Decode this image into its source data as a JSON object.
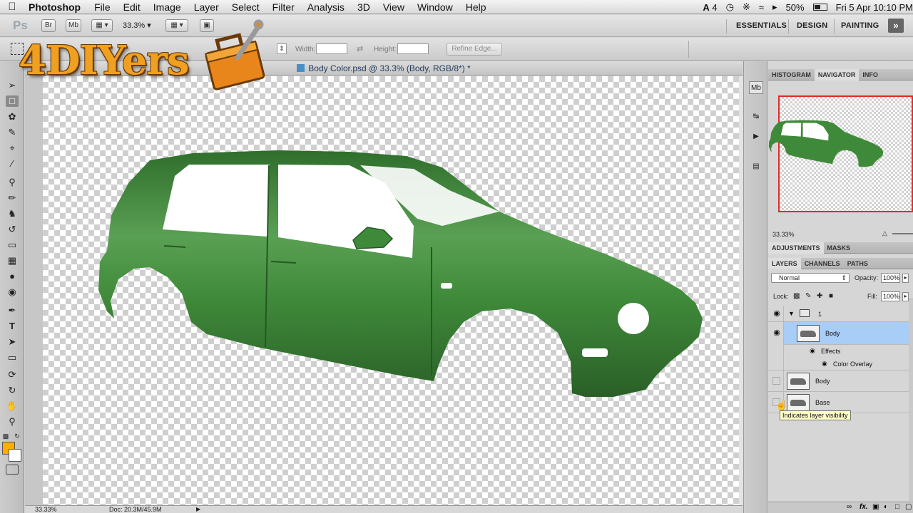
{
  "menubar": {
    "app_name": "Photoshop",
    "items": [
      "File",
      "Edit",
      "Image",
      "Layer",
      "Select",
      "Filter",
      "Analysis",
      "3D",
      "View",
      "Window",
      "Help"
    ],
    "status": {
      "adobe_count": "4",
      "battery": "50%",
      "datetime": "Fri 5 Apr  10:10 PM"
    }
  },
  "appbar": {
    "ps_logo": "Ps",
    "br_label": "Br",
    "mb_label": "Mb",
    "zoom": "33.3%",
    "workspaces": [
      "ESSENTIALS",
      "DESIGN",
      "PAINTING"
    ],
    "more_label": "»"
  },
  "options": {
    "width_label": "Width:",
    "height_label": "Height:",
    "refine_edge": "Refine Edge...",
    "width_value": "",
    "height_value": ""
  },
  "watermark": {
    "text": "4DIYers"
  },
  "document": {
    "title": "Body Color.psd @ 33.3% (Body, RGB/8*) *",
    "zoom_status": "33.33%",
    "doc_info": "Doc: 20.3M/45.9M"
  },
  "colors": {
    "foreground": "#ffae00",
    "background": "#ffffff",
    "car_body": "#3f8a3a",
    "selection_highlight": "#a8cdf6",
    "navigator_frame": "#e12a2a"
  },
  "panels": {
    "top_tabs": [
      "HISTOGRAM",
      "NAVIGATOR",
      "INFO"
    ],
    "active_top_tab": "NAVIGATOR",
    "navigator_zoom": "33.33%",
    "adjust_tabs": [
      "ADJUSTMENTS",
      "MASKS"
    ],
    "layer_tabs": [
      "LAYERS",
      "CHANNELS",
      "PATHS"
    ],
    "blend_mode": "Normal",
    "opacity_label": "Opacity:",
    "opacity_value": "100%",
    "lock_label": "Lock:",
    "fill_label": "Fill:",
    "fill_value": "100%",
    "layers": {
      "group_name": "1",
      "body_selected": "Body",
      "effects_label": "Effects",
      "effect_name": "Color Overlay",
      "body_plain": "Body",
      "base": "Base"
    },
    "tooltip": "Indicates layer visibility"
  }
}
